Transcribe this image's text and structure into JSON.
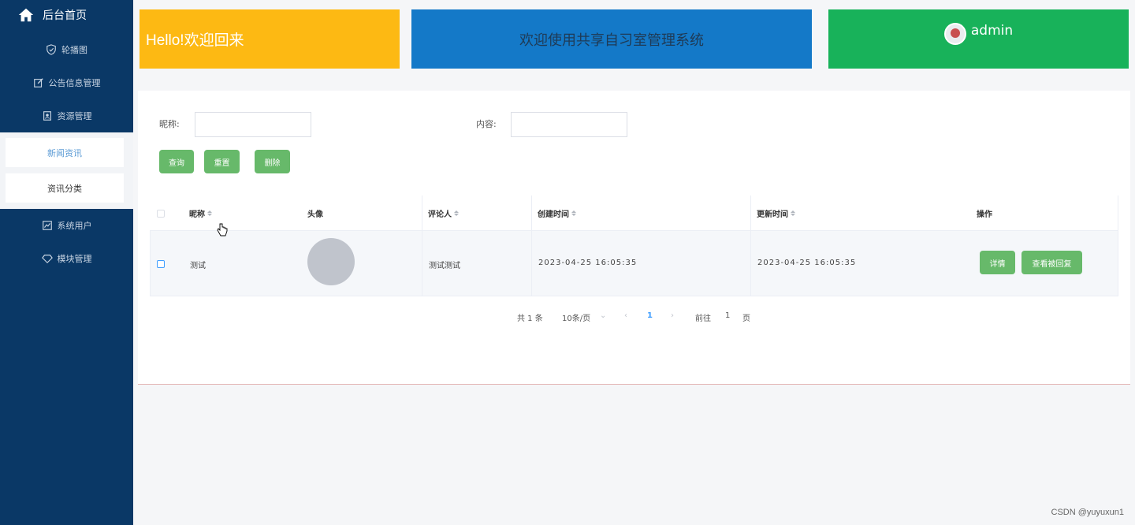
{
  "sidebar": {
    "home_label": "后台首页",
    "items": [
      {
        "label": "轮播图",
        "icon": "shield-icon"
      },
      {
        "label": "公告信息管理",
        "icon": "edit-icon"
      },
      {
        "label": "资源管理",
        "icon": "id-card-icon"
      },
      {
        "label": "系统用户",
        "icon": "chart-icon"
      },
      {
        "label": "模块管理",
        "icon": "diamond-icon"
      }
    ],
    "sub_items": [
      {
        "label": "新闻资讯",
        "active": true
      },
      {
        "label": "资讯分类",
        "active": false
      }
    ]
  },
  "header": {
    "welcome": "Hello!欢迎回来",
    "system_title": "欢迎使用共享自习室管理系统",
    "username": "admin"
  },
  "search": {
    "nickname_label": "昵称:",
    "nickname_value": "",
    "content_label": "内容:",
    "content_value": "",
    "query_btn": "查询",
    "reset_btn": "重置",
    "delete_btn": "删除"
  },
  "table": {
    "columns": [
      "昵称",
      "头像",
      "评论人",
      "创建时间",
      "更新时间",
      "操作"
    ],
    "rows": [
      {
        "nickname": "测试",
        "commenter": "测试测试",
        "created": "2023-04-25 16:05:35",
        "updated": "2023-04-25 16:05:35",
        "detail_btn": "详情",
        "reply_btn": "查看被回复"
      }
    ]
  },
  "pagination": {
    "total": "共 1 条",
    "page_size": "10条/页",
    "current_page": "1",
    "goto_label": "前往",
    "goto_value": "1",
    "page_unit": "页"
  },
  "watermark": "CSDN @yuyuxun1",
  "colors": {
    "sidebar": "#0a3866",
    "card_yellow": "#fdb913",
    "card_blue": "#1479c8",
    "card_green": "#18b25a",
    "button_green": "#67b96a"
  }
}
